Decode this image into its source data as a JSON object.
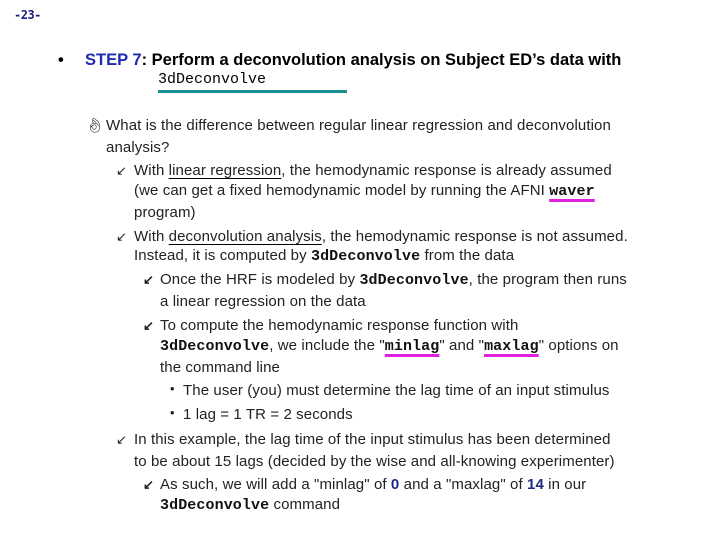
{
  "page_number": "-23-",
  "step": {
    "bullet": "•",
    "label": "STEP 7",
    "text": ": Perform a deconvolution analysis on Subject ED’s data with",
    "command": "3dDeconvolve"
  },
  "question": {
    "icon": "hand-pointer-icon",
    "line1": "What is the difference between regular linear regression and deconvolution",
    "line2": "analysis?"
  },
  "items": {
    "linear": {
      "pre": "With ",
      "term": "linear regression",
      "post": ", the hemodynamic response is already assumed",
      "line2_pre": "(we can get a fixed hemodynamic model by running the AFNI ",
      "line2_cmd": "waver",
      "line3": "program)"
    },
    "deconv": {
      "pre": "With ",
      "term": "deconvolution analysis",
      "post": ", the hemodynamic response is not assumed.",
      "line2_pre": "Instead, it is computed by ",
      "line2_cmd": "3dDeconvolve",
      "line2_post": " from the data"
    },
    "once": {
      "pre": "Once the HRF is modeled by ",
      "cmd": "3dDeconvolve",
      "post": ", the program then runs",
      "line2": "a linear regression on the data"
    },
    "compute": {
      "line1": "To compute the hemodynamic response function with",
      "cmd": "3dDeconvolve",
      "mid": ", we include the \"",
      "opt1": "minlag",
      "and": "\" and \"",
      "opt2": "maxlag",
      "post": "\" options on",
      "line3": "the command line"
    },
    "sub1": "The user (you) must determine the lag time of an input stimulus",
    "sub2": "1 lag = 1 TR = 2 seconds",
    "example": {
      "line1": "In this example, the lag time of the input stimulus has been determined",
      "line2": "to be about 15 lags (decided by the wise and all-knowing experimenter)"
    },
    "suchas": {
      "pre": "As such, we will add a \"minlag\" of ",
      "min": "0",
      "mid": " and a \"maxlag\" of ",
      "max": "14",
      "post": " in our",
      "cmd": "3dDeconvolve",
      "line2_post": " command"
    }
  },
  "bullets": {
    "arrow": "↙",
    "arrow_bold": "➘",
    "dot": "•",
    "hand": "☝"
  }
}
